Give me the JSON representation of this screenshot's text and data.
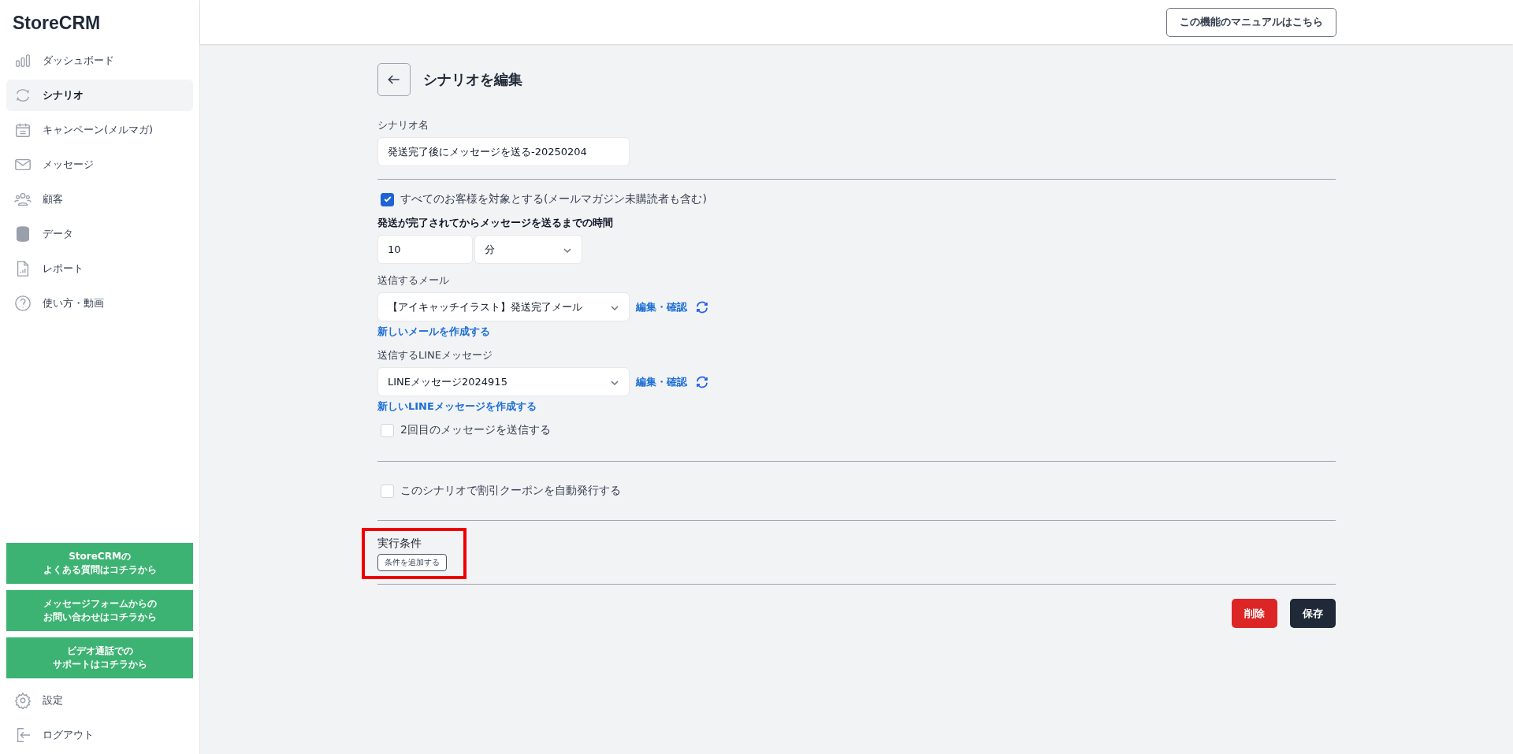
{
  "sidebar": {
    "logo": "StoreCRM",
    "items": [
      {
        "label": "ダッシュボード",
        "selected": false
      },
      {
        "label": "シナリオ",
        "selected": true
      },
      {
        "label": "キャンペーン(メルマガ)",
        "selected": false
      },
      {
        "label": "メッセージ",
        "selected": false
      },
      {
        "label": "顧客",
        "selected": false
      },
      {
        "label": "データ",
        "selected": false
      },
      {
        "label": "レポート",
        "selected": false
      },
      {
        "label": "使い方・動画",
        "selected": false
      }
    ],
    "support_buttons": [
      [
        "StoreCRMの",
        "よくある質問はコチラから"
      ],
      [
        "メッセージフォームからの",
        "お問い合わせはコチラから"
      ],
      [
        "ビデオ通話での",
        "サポートはコチラから"
      ]
    ],
    "bottom_items": [
      {
        "label": "設定",
        "selected": false
      },
      {
        "label": "ログアウト",
        "selected": false
      }
    ]
  },
  "header": {
    "manual_button": "この機能のマニュアルはこちら"
  },
  "page": {
    "title": "シナリオを編集",
    "name_label": "シナリオ名",
    "name_value": "発送完了後にメッセージを送る-20250204",
    "all_customers": {
      "label": "すべてのお客様を対象とする(メールマガジン未購読者も含む)",
      "checked": true
    },
    "delay_label": "発送が完了されてからメッセージを送るまでの時間",
    "delay_value": "10",
    "delay_unit": "分",
    "mail": {
      "label": "送信するメール",
      "value": "【アイキャッチイラスト】発送完了メール",
      "edit_link": "編集・確認",
      "new_link": "新しいメールを作成する"
    },
    "line": {
      "label": "送信するLINEメッセージ",
      "value": "LINEメッセージ2024915",
      "edit_link": "編集・確認",
      "new_link": "新しいLINEメッセージを作成する"
    },
    "second_message": {
      "label": "2回目のメッセージを送信する",
      "checked": false
    },
    "coupon": {
      "label": "このシナリオで割引クーポンを自動発行する",
      "checked": false
    },
    "conditions": {
      "label": "実行条件",
      "add_button": "条件を追加する",
      "highlighted": true
    },
    "delete_button": "削除",
    "save_button": "保存"
  }
}
